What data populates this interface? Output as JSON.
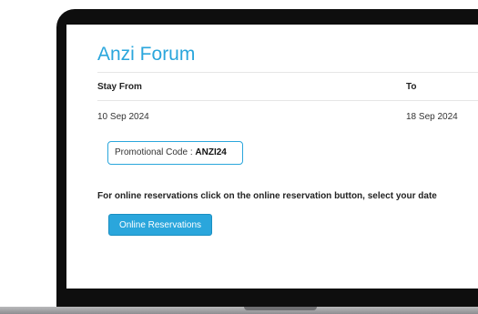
{
  "page": {
    "title": "Anzi Forum"
  },
  "stay_table": {
    "headers": [
      "Stay From",
      "To"
    ],
    "row": [
      "10 Sep 2024",
      "18 Sep 2024"
    ]
  },
  "promo": {
    "label": "Promotional Code : ",
    "code": "ANZI24"
  },
  "instructions": {
    "text": "For online reservations click on the online reservation button, select your date"
  },
  "actions": {
    "online_reservations_label": "Online Reservations"
  },
  "colors": {
    "accent": "#2aa6dc",
    "bezel": "#0e0e0e"
  }
}
